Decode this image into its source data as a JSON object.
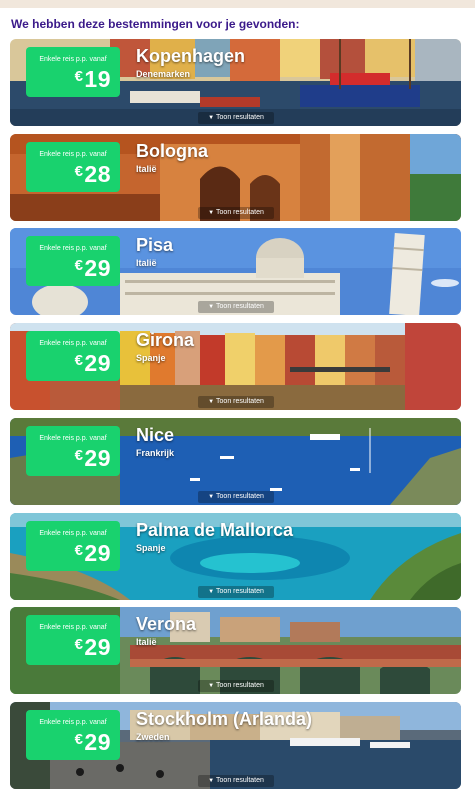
{
  "heading": "We hebben deze bestemmingen voor je gevonden:",
  "colors": {
    "heading": "#3b1a8a",
    "price_box": "#19d26e",
    "top_band": "#f1e7dc"
  },
  "results_icon": "chevron-down-icon",
  "destinations": [
    {
      "label": "Enkele reis p.p. vanaf",
      "currency": "€",
      "price": "19",
      "city": "Kopenhagen",
      "country": "Denemarken",
      "results": "Toon resultaten"
    },
    {
      "label": "Enkele reis p.p. vanaf",
      "currency": "€",
      "price": "28",
      "city": "Bologna",
      "country": "Italië",
      "results": "Toon resultaten"
    },
    {
      "label": "Enkele reis p.p. vanaf",
      "currency": "€",
      "price": "29",
      "city": "Pisa",
      "country": "Italië",
      "results": "Toon resultaten"
    },
    {
      "label": "Enkele reis p.p. vanaf",
      "currency": "€",
      "price": "29",
      "city": "Girona",
      "country": "Spanje",
      "results": "Toon resultaten"
    },
    {
      "label": "Enkele reis p.p. vanaf",
      "currency": "€",
      "price": "29",
      "city": "Nice",
      "country": "Frankrijk",
      "results": "Toon resultaten"
    },
    {
      "label": "Enkele reis p.p. vanaf",
      "currency": "€",
      "price": "29",
      "city": "Palma de Mallorca",
      "country": "Spanje",
      "results": "Toon resultaten"
    },
    {
      "label": "Enkele reis p.p. vanaf",
      "currency": "€",
      "price": "29",
      "city": "Verona",
      "country": "Italië",
      "results": "Toon resultaten"
    },
    {
      "label": "Enkele reis p.p. vanaf",
      "currency": "€",
      "price": "29",
      "city": "Stockholm (Arlanda)",
      "country": "Zweden",
      "results": "Toon resultaten"
    }
  ]
}
